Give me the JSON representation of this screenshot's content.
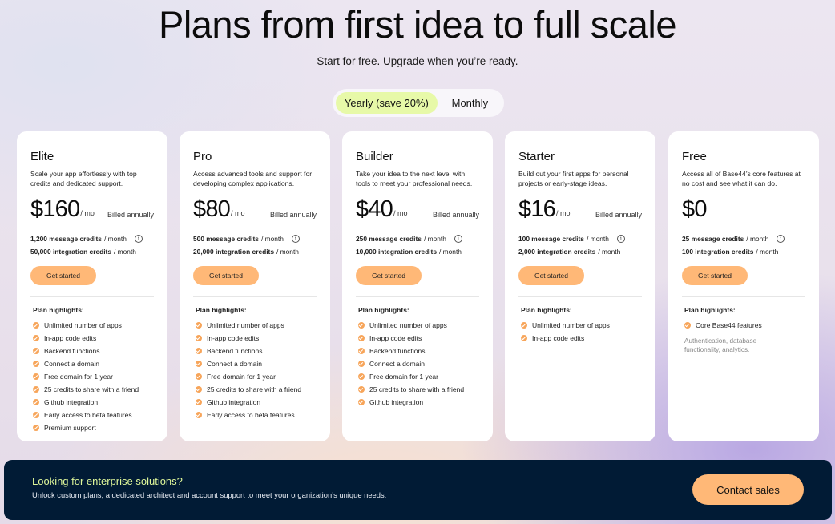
{
  "hero": {
    "title": "Plans from first idea to full scale",
    "subtitle": "Start for free. Upgrade when you’re ready."
  },
  "billing_toggle": {
    "yearly_label": "Yearly (save 20%)",
    "monthly_label": "Monthly",
    "selected": "yearly"
  },
  "colors": {
    "accent": "#ffb877",
    "toggle_active": "#e7f9a8",
    "check": "#f7a55a",
    "banner_bg": "#011b35",
    "banner_title": "#dff79a"
  },
  "plans": [
    {
      "name": "Elite",
      "description": "Scale your app effortlessly with top credits and dedicated support.",
      "price": "$160",
      "per": "/ mo",
      "billed": "Billed annually",
      "message_credits": "1,200 message credits",
      "integration_credits": "50,000 integration credits",
      "per_month": "/ month",
      "cta": "Get started",
      "highlights_title": "Plan highlights:",
      "features": [
        "Unlimited number of apps",
        "In-app code edits",
        "Backend functions",
        "Connect a domain",
        "Free domain for 1 year",
        "25 credits to share with a friend",
        "Github integration",
        "Early access to beta features",
        "Premium support"
      ]
    },
    {
      "name": "Pro",
      "description": "Access advanced tools and support for developing complex applications.",
      "price": "$80",
      "per": "/ mo",
      "billed": "Billed annually",
      "message_credits": "500 message credits",
      "integration_credits": "20,000 integration credits",
      "per_month": "/ month",
      "cta": "Get started",
      "highlights_title": "Plan highlights:",
      "features": [
        "Unlimited number of apps",
        "In-app code edits",
        "Backend functions",
        "Connect a domain",
        "Free domain for 1 year",
        "25 credits to share with a friend",
        "Github integration",
        "Early access to beta features"
      ]
    },
    {
      "name": "Builder",
      "description": "Take your idea to the next level with tools to meet your professional needs.",
      "price": "$40",
      "per": "/ mo",
      "billed": "Billed annually",
      "message_credits": "250 message credits",
      "integration_credits": "10,000 integration credits",
      "per_month": "/ month",
      "cta": "Get started",
      "highlights_title": "Plan highlights:",
      "features": [
        "Unlimited number of apps",
        "In-app code edits",
        "Backend functions",
        "Connect a domain",
        "Free domain for 1 year",
        "25 credits to share with a friend",
        "Github integration"
      ]
    },
    {
      "name": "Starter",
      "description": "Build out your first apps for personal projects or early-stage ideas.",
      "price": "$16",
      "per": "/ mo",
      "billed": "Billed annually",
      "message_credits": "100 message credits",
      "integration_credits": "2,000 integration credits",
      "per_month": "/ month",
      "cta": "Get started",
      "highlights_title": "Plan highlights:",
      "features": [
        "Unlimited number of apps",
        "In-app code edits"
      ]
    },
    {
      "name": "Free",
      "description": "Access all of Base44’s core features at no cost and see what it can do.",
      "price": "$0",
      "per": "",
      "billed": "",
      "message_credits": "25 message credits",
      "integration_credits": "100 integration credits",
      "per_month": "/ month",
      "cta": "Get started",
      "highlights_title": "Plan highlights:",
      "features": [
        "Core Base44 features"
      ],
      "note": "Authentication, database functionality, analytics."
    }
  ],
  "enterprise": {
    "title": "Looking for enterprise solutions?",
    "description": "Unlock custom plans, a dedicated architect and account support to meet your organization’s unique needs.",
    "cta": "Contact sales"
  }
}
